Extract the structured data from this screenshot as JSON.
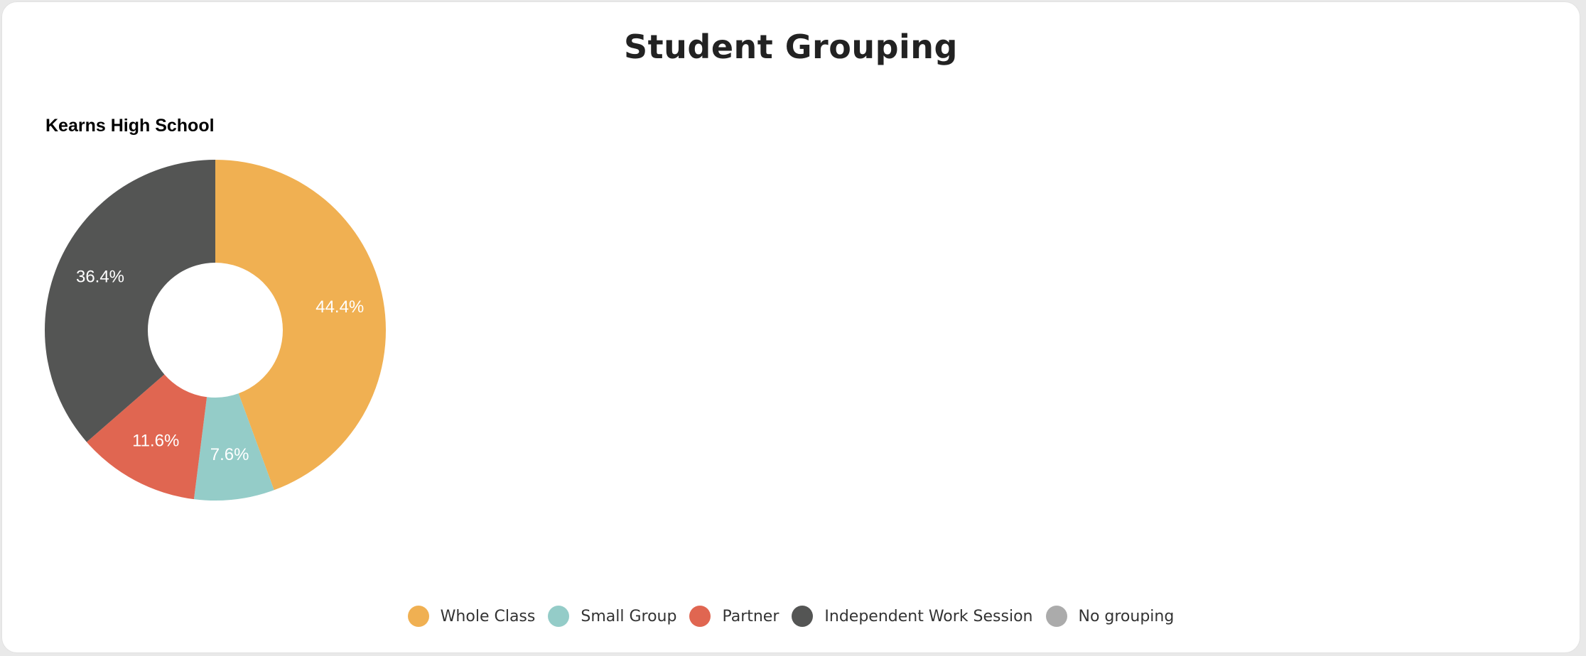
{
  "chart_data": {
    "type": "pie",
    "title": "Student Grouping",
    "subtitle": "Kearns High School",
    "series": [
      {
        "name": "Whole Class",
        "value": 44.4,
        "label": "44.4%",
        "color": "#F0B052"
      },
      {
        "name": "Small Group",
        "value": 7.6,
        "label": "7.6%",
        "color": "#94CCC8"
      },
      {
        "name": "Partner",
        "value": 11.6,
        "label": "11.6%",
        "color": "#E06651"
      },
      {
        "name": "Independent Work Session",
        "value": 36.4,
        "label": "36.4%",
        "color": "#545554"
      },
      {
        "name": "No grouping",
        "value": 0,
        "label": "",
        "color": "#ABABAB"
      }
    ],
    "legend_placement": "bottom"
  }
}
